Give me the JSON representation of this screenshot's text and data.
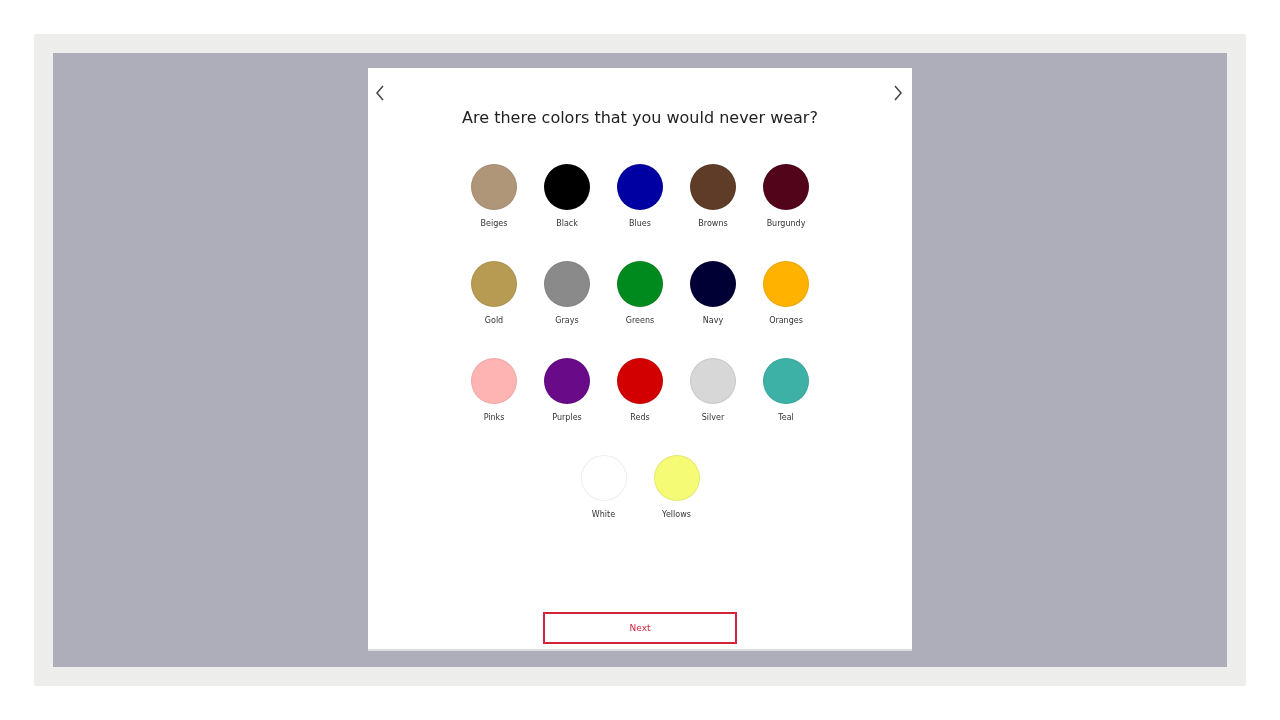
{
  "title": "Are there colors that you would never wear?",
  "colors": [
    {
      "label": "Beiges",
      "color": "#af9679"
    },
    {
      "label": "Black",
      "color": "#000000"
    },
    {
      "label": "Blues",
      "color": "#0000a2"
    },
    {
      "label": "Browns",
      "color": "#5f3c28"
    },
    {
      "label": "Burgundy",
      "color": "#52051a"
    },
    {
      "label": "Gold",
      "color": "#b79b52"
    },
    {
      "label": "Grays",
      "color": "#8a8a8a"
    },
    {
      "label": "Greens",
      "color": "#008a1d"
    },
    {
      "label": "Navy",
      "color": "#000035"
    },
    {
      "label": "Oranges",
      "color": "#ffb200"
    },
    {
      "label": "Pinks",
      "color": "#ffb4b4"
    },
    {
      "label": "Purples",
      "color": "#690a89"
    },
    {
      "label": "Reds",
      "color": "#d20000"
    },
    {
      "label": "Silver",
      "color": "#d7d7d7"
    },
    {
      "label": "Teal",
      "color": "#3eb1a6"
    },
    {
      "label": "White",
      "color": "#ffffff"
    },
    {
      "label": "Yellows",
      "color": "#f6fb76"
    }
  ],
  "next_button": "Next"
}
